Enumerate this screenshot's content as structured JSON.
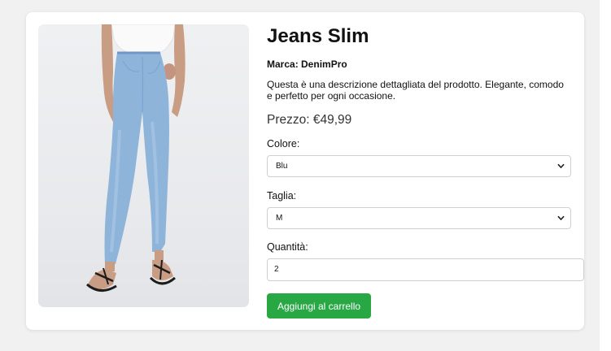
{
  "product": {
    "title": "Jeans Slim",
    "brand_text": "Marca: DenimPro",
    "description": "Questa è una descrizione dettagliata del prodotto. Elegante, comodo e perfetto per ogni occasione.",
    "price_text": "Prezzo: €49,99",
    "image_subject": "model wearing light blue slim jeans"
  },
  "options": {
    "color_label": "Colore:",
    "color_value": "Blu",
    "size_label": "Taglia:",
    "size_value": "M",
    "quantity_label": "Quantità:",
    "quantity_value": "2"
  },
  "actions": {
    "add_to_cart_label": "Aggiungi al carrello"
  },
  "colors": {
    "page_background": "#f1f1f1",
    "card_background": "#ffffff",
    "button_green": "#28a745",
    "denim_blue": "#8fb4da"
  },
  "icons": {
    "select_arrow": "chevron-down-icon"
  }
}
